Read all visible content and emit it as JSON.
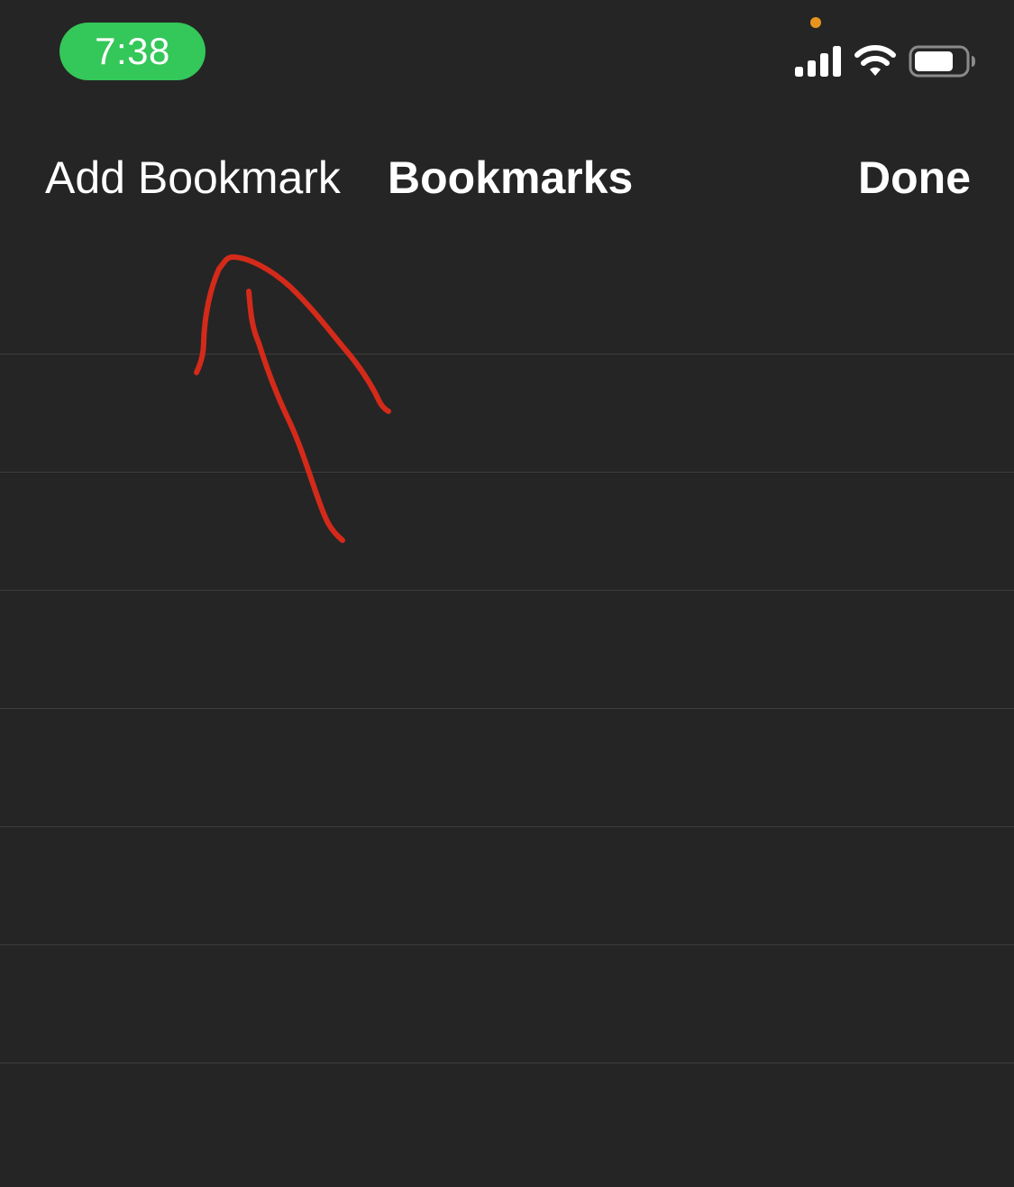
{
  "status_bar": {
    "time": "7:38",
    "time_pill_color": "#34c759",
    "privacy_dot_color": "#e8951f",
    "icons": [
      "signal-icon",
      "wifi-icon",
      "battery-icon"
    ]
  },
  "nav": {
    "left_button_label": "Add Bookmark",
    "title": "Bookmarks",
    "right_button_label": "Done"
  },
  "list": {
    "row_count": 7
  },
  "annotation": {
    "type": "hand-drawn-arrow",
    "color": "#d42a1a"
  }
}
